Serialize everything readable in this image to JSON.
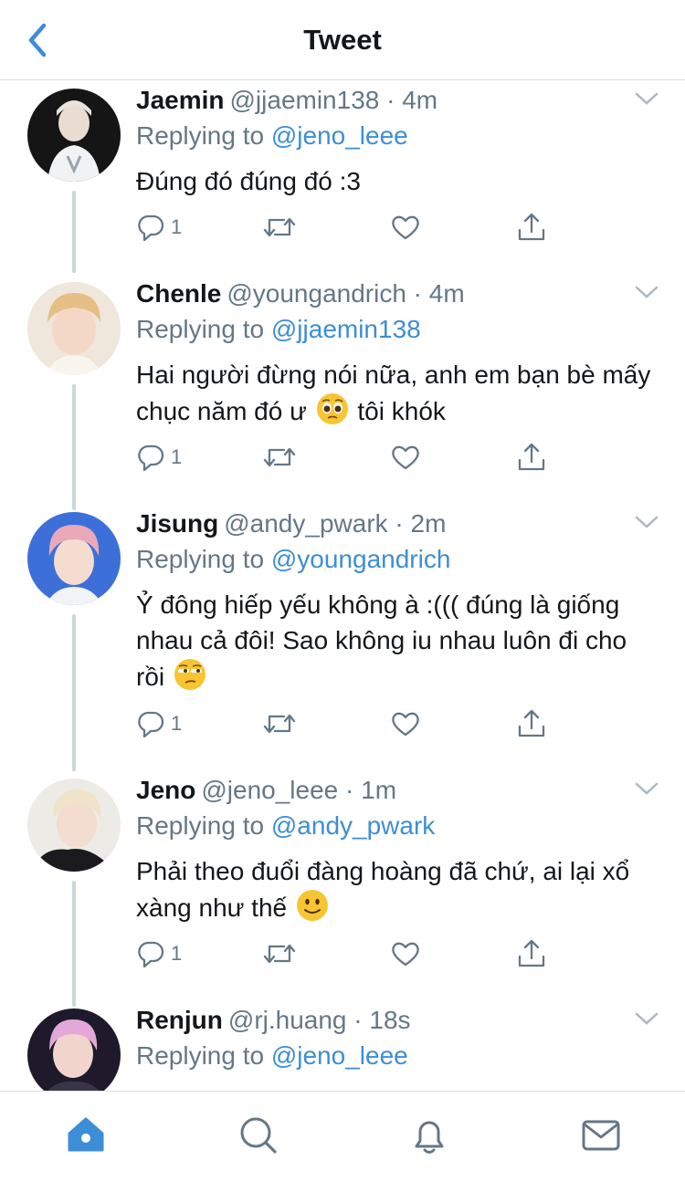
{
  "header": {
    "title": "Tweet"
  },
  "replying_prefix": "Replying to",
  "tweets": [
    {
      "name": "Jaemin",
      "handle": "@jjaemin138",
      "time": "4m",
      "reply_to": "@jeno_leee",
      "text": "Đúng đó đúng đó :3",
      "reply_count": "1"
    },
    {
      "name": "Chenle",
      "handle": "@youngandrich",
      "time": "4m",
      "reply_to": "@jjaemin138",
      "text_a": "Hai người đừng nói nữa, anh em bạn bè mấy chục năm đó ư",
      "emoji": "pleading-face",
      "text_b": "tôi khók",
      "reply_count": "1"
    },
    {
      "name": "Jisung",
      "handle": "@andy_pwark",
      "time": "2m",
      "reply_to": "@youngandrich",
      "text_a": "Ỷ đông hiếp yếu không à :((( đúng là giống nhau cả đôi! Sao không iu nhau luôn đi cho rồi",
      "emoji": "unamused-face",
      "reply_count": "1"
    },
    {
      "name": "Jeno",
      "handle": "@jeno_leee",
      "time": "1m",
      "reply_to": "@andy_pwark",
      "text_a": "Phải theo đuổi đàng hoàng đã chứ, ai lại xổ xàng như thế",
      "emoji": "slightly-smiling-face",
      "reply_count": "1"
    },
    {
      "name": "Renjun",
      "handle": "@rj.huang",
      "time": "18s",
      "reply_to": "@jeno_leee"
    }
  ],
  "colors": {
    "accent": "#3d8ed6",
    "muted": "#657786",
    "line": "#ccd6dd"
  },
  "tabs": [
    "home-icon",
    "search-icon",
    "notifications-icon",
    "messages-icon"
  ]
}
